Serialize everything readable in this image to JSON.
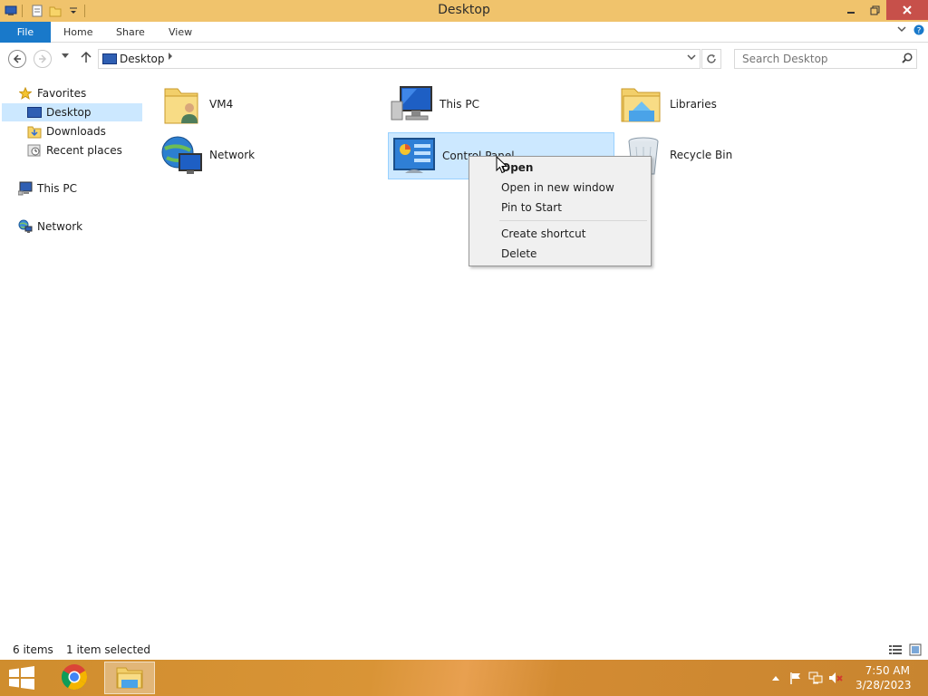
{
  "window": {
    "title": "Desktop"
  },
  "ribbon": {
    "tabs": [
      {
        "label": "File"
      },
      {
        "label": "Home"
      },
      {
        "label": "Share"
      },
      {
        "label": "View"
      }
    ]
  },
  "address": {
    "location": "Desktop"
  },
  "search": {
    "placeholder": "Search Desktop"
  },
  "nav_pane": {
    "favorites_label": "Favorites",
    "favorites_items": [
      {
        "label": "Desktop",
        "selected": true
      },
      {
        "label": "Downloads"
      },
      {
        "label": "Recent places"
      }
    ],
    "this_pc_label": "This PC",
    "network_label": "Network"
  },
  "items": [
    {
      "label": "VM4",
      "icon": "user-folder-icon"
    },
    {
      "label": "This PC",
      "icon": "computer-icon"
    },
    {
      "label": "Libraries",
      "icon": "libraries-icon"
    },
    {
      "label": "Network",
      "icon": "network-icon"
    },
    {
      "label": "Control Panel",
      "icon": "control-panel-icon",
      "selected": true
    },
    {
      "label": "Recycle Bin",
      "icon": "recycle-bin-icon"
    }
  ],
  "context_menu": {
    "items": [
      {
        "label": "Open",
        "bold": true
      },
      {
        "label": "Open in new window"
      },
      {
        "label": "Pin to Start"
      },
      {
        "label": "Create shortcut"
      },
      {
        "label": "Delete"
      }
    ]
  },
  "status": {
    "item_count": "6 items",
    "selection": "1 item selected"
  },
  "taskbar": {
    "apps": [
      "chrome-icon",
      "file-explorer-icon"
    ],
    "time": "7:50 AM",
    "date": "3/28/2023"
  },
  "colors": {
    "title_bar": "#f0c36c",
    "file_tab": "#1979ca",
    "selection": "#cce8ff",
    "taskbar": "#d99436"
  }
}
